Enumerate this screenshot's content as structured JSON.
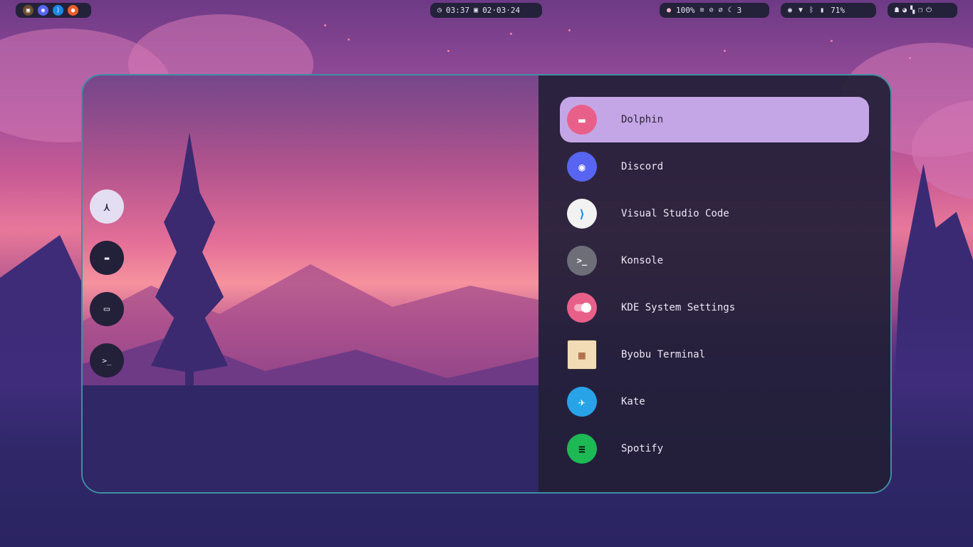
{
  "topbar": {
    "left_apps": [
      {
        "icon": "konsole-cat-icon",
        "color": "#6b4e2e"
      },
      {
        "icon": "discord-icon",
        "color": "#5865f2"
      },
      {
        "icon": "vscode-icon",
        "color": "#1e88e5"
      },
      {
        "icon": "firefox-icon",
        "color": "#e8602c"
      }
    ],
    "clock": {
      "time": "03:37",
      "date": "02·03·24"
    },
    "status": {
      "volume": "100%",
      "notifications": "3"
    },
    "battery": "71%"
  },
  "launcher": {
    "sidebar": [
      {
        "icon": "arch-icon",
        "glyph": "⋏",
        "active": true
      },
      {
        "icon": "folder-icon",
        "glyph": "▬",
        "active": false
      },
      {
        "icon": "window-icon",
        "glyph": "▭",
        "active": false
      },
      {
        "icon": "terminal-icon",
        "glyph": ">_",
        "active": false
      }
    ],
    "apps": [
      {
        "label": "Dolphin",
        "icon": "dolphin-icon",
        "color": "#e8608a",
        "glyph": "▬"
      },
      {
        "label": "Discord",
        "icon": "discord-icon",
        "color": "#5865f2",
        "glyph": "◉"
      },
      {
        "label": "Visual Studio Code",
        "icon": "vscode-icon",
        "color": "#f2f2f2",
        "glyph": "⟩"
      },
      {
        "label": "Konsole",
        "icon": "konsole-icon",
        "color": "#6e6e78",
        "glyph": ">_"
      },
      {
        "label": "KDE System Settings",
        "icon": "settings-toggle-icon",
        "color": "#e8608a",
        "glyph": "●"
      },
      {
        "label": "Byobu Terminal",
        "icon": "byobu-map-icon",
        "color": "#f2dcb6",
        "glyph": "▦"
      },
      {
        "label": "Kate",
        "icon": "kate-icon",
        "color": "#29a3e8",
        "glyph": "✈"
      },
      {
        "label": "Spotify",
        "icon": "spotify-icon",
        "color": "#1db954",
        "glyph": "≡"
      }
    ],
    "selected_index": 0
  }
}
